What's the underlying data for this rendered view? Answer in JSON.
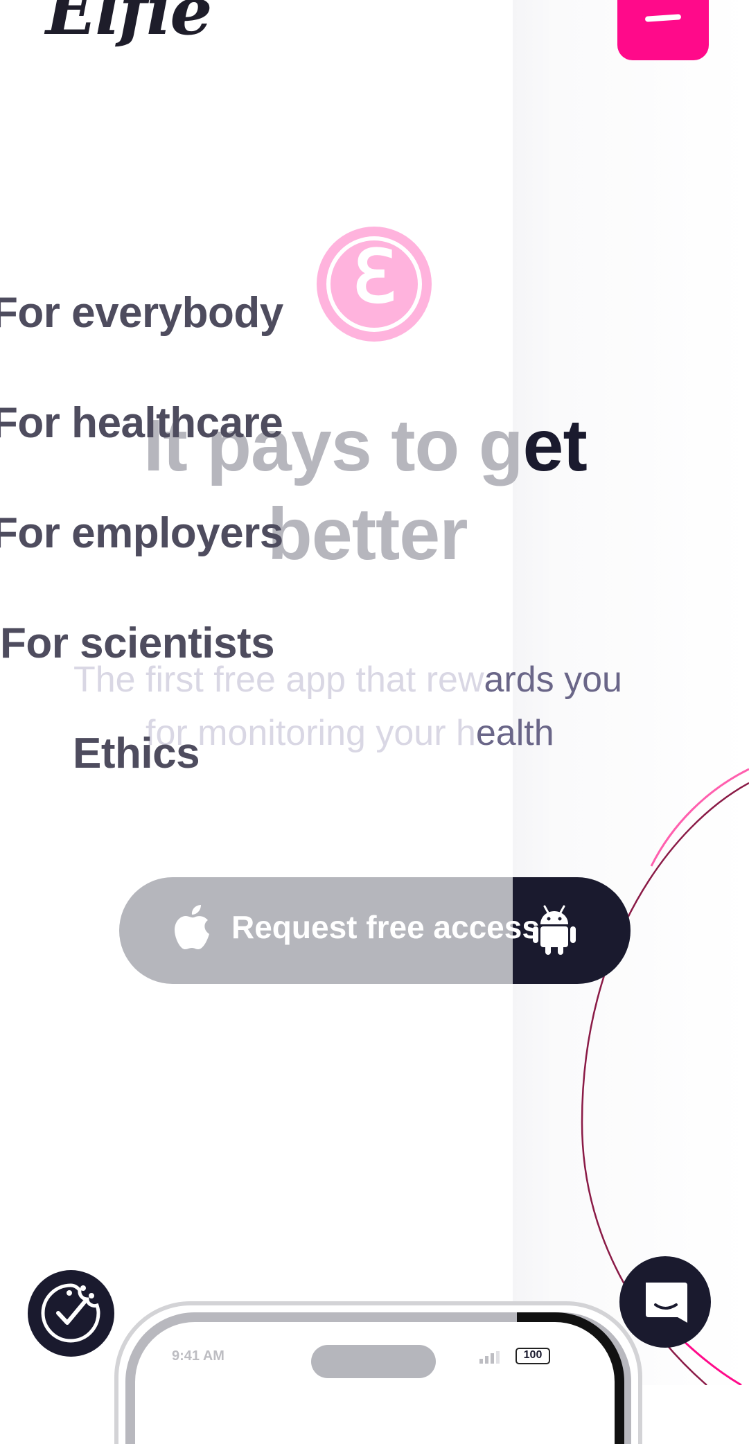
{
  "header": {
    "logo_text": "Elfie",
    "menu_button_label": ""
  },
  "menu": {
    "items": [
      {
        "label": "For everybody"
      },
      {
        "label": "For healthcare"
      },
      {
        "label": "For employers"
      },
      {
        "label": "For scientists"
      },
      {
        "label": "Ethics"
      }
    ]
  },
  "hero": {
    "coin_symbol": "ℇ",
    "title_line1_dim": "It pays to g",
    "title_line1_dark": "et",
    "title_line2_dim": "better",
    "subtitle_line1_dim": "The first free app that rew",
    "subtitle_line1_dark": "ards you",
    "subtitle_line2_dim": "for monitoring your h",
    "subtitle_line2_dark": "ealth"
  },
  "cta": {
    "label": "Request free access"
  },
  "phone": {
    "time": "9:41 AM",
    "battery": "100"
  },
  "icons": {
    "apple": "apple-icon",
    "android": "android-icon",
    "cookie": "cookie-check-icon",
    "chat": "chat-icon",
    "signal": "signal-icon",
    "battery": "battery-icon"
  },
  "colors": {
    "brand_pink": "#ff0a8a",
    "coin_pink": "#ffb3dd",
    "navy": "#1a1a2e",
    "menu_text": "#4e4c5e",
    "muted_gray": "#b6b6bd"
  }
}
